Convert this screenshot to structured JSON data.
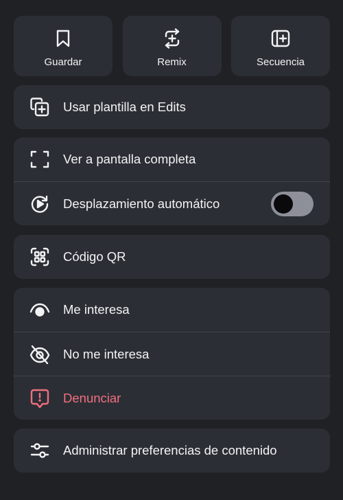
{
  "quick_actions": [
    {
      "label": "Guardar",
      "icon": "bookmark-icon"
    },
    {
      "label": "Remix",
      "icon": "remix-icon"
    },
    {
      "label": "Secuencia",
      "icon": "sequence-icon"
    }
  ],
  "edits_card": {
    "template_label": "Usar plantilla en Edits",
    "template_icon": "copy-add-icon"
  },
  "view_card": {
    "fullscreen_label": "Ver a pantalla completa",
    "fullscreen_icon": "fullscreen-icon",
    "autoscroll_label": "Desplazamiento automático",
    "autoscroll_icon": "autoscroll-icon",
    "autoscroll_enabled": false
  },
  "qr_card": {
    "qr_label": "Código QR",
    "qr_icon": "qr-code-icon"
  },
  "feedback_card": {
    "interested_label": "Me interesa",
    "interested_icon": "eye-icon",
    "not_interested_label": "No me interesa",
    "not_interested_icon": "eye-off-icon",
    "report_label": "Denunciar",
    "report_icon": "report-icon"
  },
  "preferences_card": {
    "preferences_label": "Administrar preferencias de contenido",
    "preferences_icon": "sliders-icon"
  },
  "colors": {
    "background": "#202125",
    "card": "#2c2e35",
    "text": "#f2f3f5",
    "danger": "#f0707f",
    "toggle_track": "#8d9099",
    "toggle_knob": "#0a0a0c"
  }
}
